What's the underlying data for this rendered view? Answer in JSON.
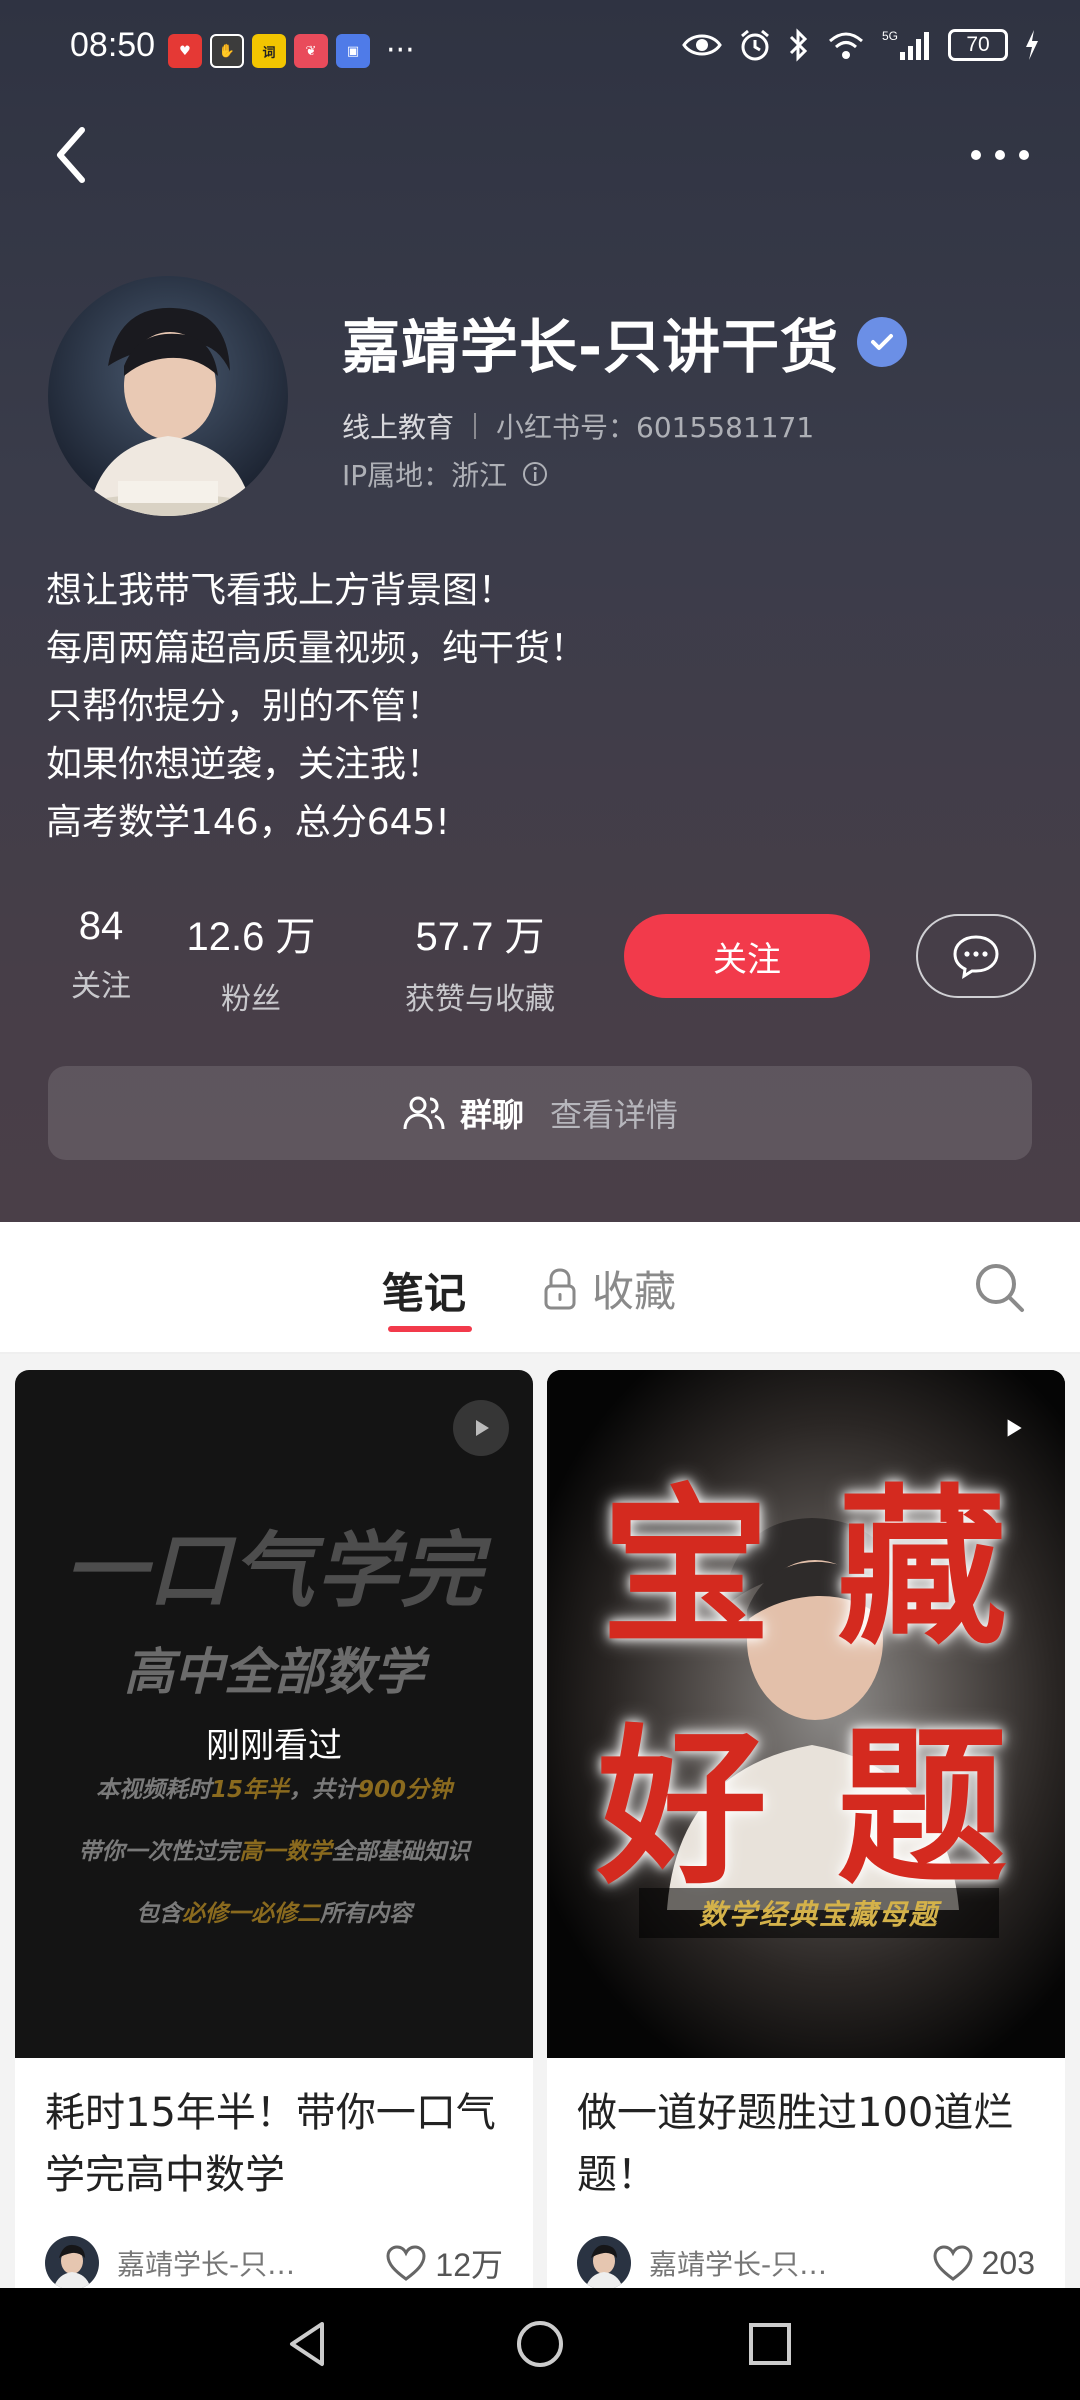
{
  "status_bar": {
    "time": "08:50",
    "apps": [
      {
        "icon": "app-heart-icon",
        "label": "",
        "color": "#e53935"
      },
      {
        "icon": "app-hand-icon",
        "label": "",
        "color": "#3c3c3c"
      },
      {
        "icon": "app-yellow-icon",
        "label": "词",
        "color": "#f2c500"
      },
      {
        "icon": "app-red-icon",
        "label": "",
        "color": "#e94b5b"
      },
      {
        "icon": "app-blue-icon",
        "label": "",
        "color": "#4f7be8"
      }
    ],
    "more": "···",
    "battery": "70"
  },
  "profile": {
    "name": "嘉靖学长-只讲干货",
    "category": "线上教育",
    "redbook_id": "小红书号：6015581171",
    "ip_location": "IP属地：浙江",
    "bio": [
      "想让我带飞看我上方背景图！",
      "每周两篇超高质量视频，纯干货！",
      "只帮你提分，别的不管！",
      "如果你想逆袭，关注我！",
      "高考数学146，总分645!"
    ],
    "stats": [
      {
        "value": "84",
        "label": "关注"
      },
      {
        "value": "12.6 万",
        "label": "粉丝"
      },
      {
        "value": "57.7 万",
        "label": "获赞与收藏"
      }
    ],
    "follow_label": "关注",
    "group_chat": {
      "title": "群聊",
      "detail": "查看详情"
    }
  },
  "tabs": {
    "notes": "笔记",
    "favorites": "收藏"
  },
  "notes": [
    {
      "title": "耗时15年半！带你一口气学完高中数学",
      "author": "嘉靖学长-只…",
      "likes": "12万",
      "cover": {
        "headline": "一口气学完",
        "subhead": "高中全部数学",
        "seen": "刚刚看过",
        "line1_a": "本视频耗时",
        "line1_b": "15年半",
        "line1_c": "，共计",
        "line1_d": "900分钟",
        "line2_a": "带你一次性过完",
        "line2_b": "高一数学",
        "line2_c": "全部基础知识",
        "line3_a": "包含",
        "line3_b": "必修一必修二",
        "line3_c": "所有内容"
      }
    },
    {
      "title": "做一道好题胜过100道烂题！",
      "author": "嘉靖学长-只讲…",
      "likes": "203",
      "cover": {
        "c1": "宝",
        "c2": "藏",
        "c3": "好",
        "c4": "题",
        "tag": "数学经典宝藏母题"
      }
    }
  ],
  "colors": {
    "accent": "#f23a4b",
    "verify": "#6b8fe6"
  }
}
